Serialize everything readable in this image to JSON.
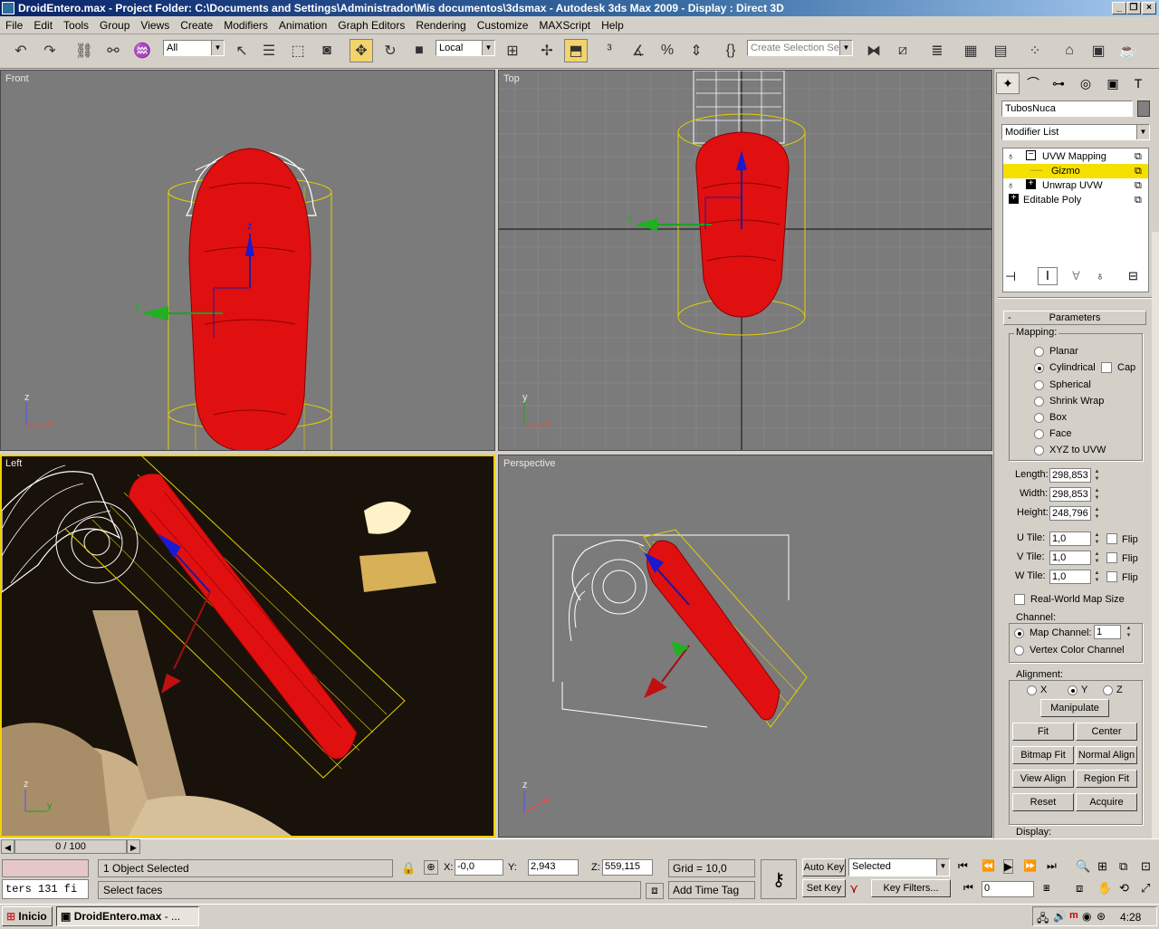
{
  "window": {
    "title": "DroidEntero.max     - Project Folder: C:\\Documents and Settings\\Administrador\\Mis documentos\\3dsmax     - Autodesk 3ds Max  2009      - Display : Direct 3D"
  },
  "menu": [
    "File",
    "Edit",
    "Tools",
    "Group",
    "Views",
    "Create",
    "Modifiers",
    "Animation",
    "Graph Editors",
    "Rendering",
    "Customize",
    "MAXScript",
    "Help"
  ],
  "toolbar": {
    "filter_value": "All",
    "coord_system": "Local",
    "selection_set_placeholder": "Create Selection Set"
  },
  "viewports": {
    "front": "Front",
    "top": "Top",
    "left": "Left",
    "perspective": "Perspective"
  },
  "axes": {
    "x": "x",
    "y": "y",
    "z": "z"
  },
  "command_panel": {
    "object_name": "TubosNuca",
    "modifier_list": "Modifier List",
    "stack": [
      {
        "label": "UVW Mapping",
        "expanded": "−"
      },
      {
        "label": "Gizmo"
      },
      {
        "label": "Unwrap UVW",
        "expanded": "+"
      },
      {
        "label": "Editable Poly",
        "expanded": "+"
      }
    ],
    "rollout_title": "Parameters",
    "mapping": {
      "label": "Mapping:",
      "options": [
        "Planar",
        "Cylindrical",
        "Spherical",
        "Shrink Wrap",
        "Box",
        "Face",
        "XYZ to UVW"
      ],
      "selected": "Cylindrical",
      "cap_label": "Cap"
    },
    "dimensions": {
      "length_label": "Length:",
      "length": "298,853",
      "width_label": "Width:",
      "width": "298,853",
      "height_label": "Height:",
      "height": "248,796"
    },
    "tiles": {
      "u_label": "U Tile:",
      "u": "1,0",
      "v_label": "V Tile:",
      "v": "1,0",
      "w_label": "W Tile:",
      "w": "1,0",
      "flip_label": "Flip"
    },
    "real_world_label": "Real-World Map Size",
    "channel": {
      "label": "Channel:",
      "map_channel_label": "Map Channel:",
      "map_channel": "1",
      "vertex_color_label": "Vertex Color Channel"
    },
    "alignment": {
      "label": "Alignment:",
      "x": "X",
      "y": "Y",
      "z": "Z",
      "manipulate": "Manipulate",
      "fit": "Fit",
      "center": "Center",
      "bitmap_fit": "Bitmap Fit",
      "normal_align": "Normal Align",
      "view_align": "View Align",
      "region_fit": "Region Fit",
      "reset": "Reset",
      "acquire": "Acquire"
    },
    "display_label": "Display:"
  },
  "status": {
    "time_slider": "0 / 100",
    "selected_info": "1 Object Selected",
    "prompt": "Select faces",
    "script_listener": "ters 131 fi",
    "x_label": "X:",
    "x": "-0,0",
    "y_label": "Y:",
    "y": "2,943",
    "z_label": "Z:",
    "z": "559,115",
    "grid": "Grid = 10,0",
    "add_time_tag": "Add Time Tag",
    "auto_key": "Auto Key",
    "set_key": "Set Key",
    "key_mode": "Selected",
    "key_filters": "Key Filters...",
    "frame": "0"
  },
  "taskbar": {
    "start": "Inicio",
    "task": "DroidEntero.max",
    "task_more": "- ...",
    "clock": "4:28"
  },
  "colors": {
    "titlebar": "#0a246a",
    "selected_object": "#e01010",
    "gizmo": "#e6d000",
    "active_viewport": "#f0d000",
    "stack_highlight": "#f5e000"
  }
}
